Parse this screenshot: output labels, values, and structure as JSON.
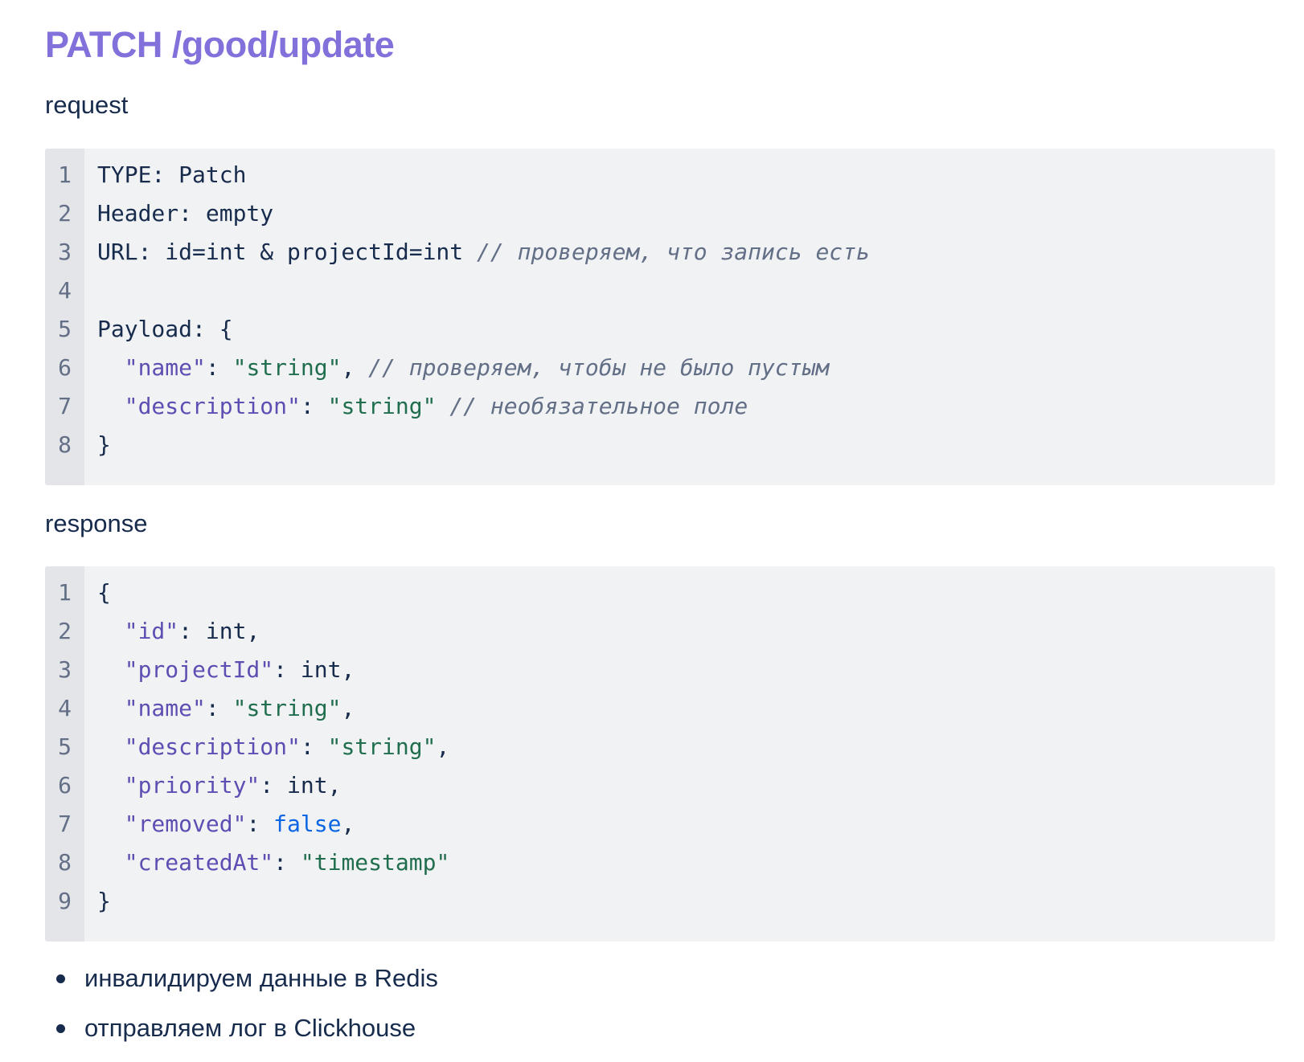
{
  "title": "PATCH /good/update",
  "request": {
    "label": "request",
    "lines": [
      {
        "num": "1",
        "tokens": [
          {
            "t": "TYPE: Patch",
            "c": "plain"
          }
        ]
      },
      {
        "num": "2",
        "tokens": [
          {
            "t": "Header: empty",
            "c": "plain"
          }
        ]
      },
      {
        "num": "3",
        "tokens": [
          {
            "t": "URL: id=int & projectId=int ",
            "c": "plain"
          },
          {
            "t": "// проверяем, что запись есть",
            "c": "cmt"
          }
        ]
      },
      {
        "num": "4",
        "tokens": []
      },
      {
        "num": "5",
        "tokens": [
          {
            "t": "Payload: {",
            "c": "plain"
          }
        ]
      },
      {
        "num": "6",
        "tokens": [
          {
            "t": "  ",
            "c": "plain"
          },
          {
            "t": "\"name\"",
            "c": "key"
          },
          {
            "t": ": ",
            "c": "plain"
          },
          {
            "t": "\"string\"",
            "c": "str"
          },
          {
            "t": ", ",
            "c": "plain"
          },
          {
            "t": "// проверяем, чтобы не было пустым",
            "c": "cmt"
          }
        ]
      },
      {
        "num": "7",
        "tokens": [
          {
            "t": "  ",
            "c": "plain"
          },
          {
            "t": "\"description\"",
            "c": "key"
          },
          {
            "t": ": ",
            "c": "plain"
          },
          {
            "t": "\"string\"",
            "c": "str"
          },
          {
            "t": " ",
            "c": "plain"
          },
          {
            "t": "// необязательное поле",
            "c": "cmt"
          }
        ]
      },
      {
        "num": "8",
        "tokens": [
          {
            "t": "}",
            "c": "plain"
          }
        ]
      }
    ]
  },
  "response": {
    "label": "response",
    "lines": [
      {
        "num": "1",
        "tokens": [
          {
            "t": "{",
            "c": "plain"
          }
        ]
      },
      {
        "num": "2",
        "tokens": [
          {
            "t": "  ",
            "c": "plain"
          },
          {
            "t": "\"id\"",
            "c": "key"
          },
          {
            "t": ": int,",
            "c": "plain"
          }
        ]
      },
      {
        "num": "3",
        "tokens": [
          {
            "t": "  ",
            "c": "plain"
          },
          {
            "t": "\"projectId\"",
            "c": "key"
          },
          {
            "t": ": int,",
            "c": "plain"
          }
        ]
      },
      {
        "num": "4",
        "tokens": [
          {
            "t": "  ",
            "c": "plain"
          },
          {
            "t": "\"name\"",
            "c": "key"
          },
          {
            "t": ": ",
            "c": "plain"
          },
          {
            "t": "\"string\"",
            "c": "str"
          },
          {
            "t": ",",
            "c": "plain"
          }
        ]
      },
      {
        "num": "5",
        "tokens": [
          {
            "t": "  ",
            "c": "plain"
          },
          {
            "t": "\"description\"",
            "c": "key"
          },
          {
            "t": ": ",
            "c": "plain"
          },
          {
            "t": "\"string\"",
            "c": "str"
          },
          {
            "t": ",",
            "c": "plain"
          }
        ]
      },
      {
        "num": "6",
        "tokens": [
          {
            "t": "  ",
            "c": "plain"
          },
          {
            "t": "\"priority\"",
            "c": "key"
          },
          {
            "t": ": int,",
            "c": "plain"
          }
        ]
      },
      {
        "num": "7",
        "tokens": [
          {
            "t": "  ",
            "c": "plain"
          },
          {
            "t": "\"removed\"",
            "c": "key"
          },
          {
            "t": ": ",
            "c": "plain"
          },
          {
            "t": "false",
            "c": "kw"
          },
          {
            "t": ",",
            "c": "plain"
          }
        ]
      },
      {
        "num": "8",
        "tokens": [
          {
            "t": "  ",
            "c": "plain"
          },
          {
            "t": "\"createdAt\"",
            "c": "key"
          },
          {
            "t": ": ",
            "c": "plain"
          },
          {
            "t": "\"timestamp\"",
            "c": "str"
          }
        ]
      },
      {
        "num": "9",
        "tokens": [
          {
            "t": "}",
            "c": "plain"
          }
        ]
      }
    ]
  },
  "bullets": [
    "инвалидируем данные в Redis",
    "отправляем лог в Clickhouse"
  ],
  "colors": {
    "title": "#8270db",
    "text": "#172b4d",
    "code_background": "#f1f2f4",
    "gutter_background": "#e3e5e9",
    "key": "#5e4db2",
    "string": "#216e4e",
    "keyword": "#0c66e4",
    "comment": "#626f86"
  }
}
